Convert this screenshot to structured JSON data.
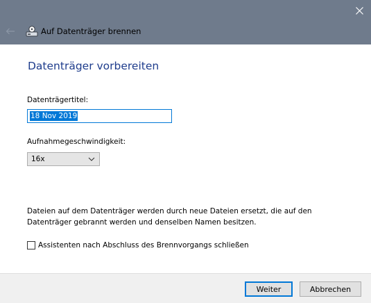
{
  "window": {
    "wizard_title": "Auf Datenträger brennen",
    "icons": {
      "close": "close-icon",
      "back": "back-arrow-icon",
      "wizard": "burn-disc-icon",
      "dropdown": "chevron-down-icon"
    },
    "colors": {
      "titlebar": "#6f7b8c",
      "heading": "#1e3c8c",
      "accent": "#0078d7"
    }
  },
  "page": {
    "heading": "Datenträger vorbereiten",
    "disc_title_label": "Datenträgertitel:",
    "disc_title_value": "18 Nov 2019",
    "speed_label": "Aufnahmegeschwindigkeit:",
    "speed_value": "16x",
    "info_text": "Dateien auf dem Datenträger werden durch neue Dateien ersetzt, die auf den Datenträger gebrannt werden und denselben Namen besitzen.",
    "close_wizard_checkbox_label": "Assistenten nach Abschluss des Brennvorgangs schließen",
    "close_wizard_checked": false
  },
  "footer": {
    "next_label": "Weiter",
    "cancel_label": "Abbrechen"
  }
}
